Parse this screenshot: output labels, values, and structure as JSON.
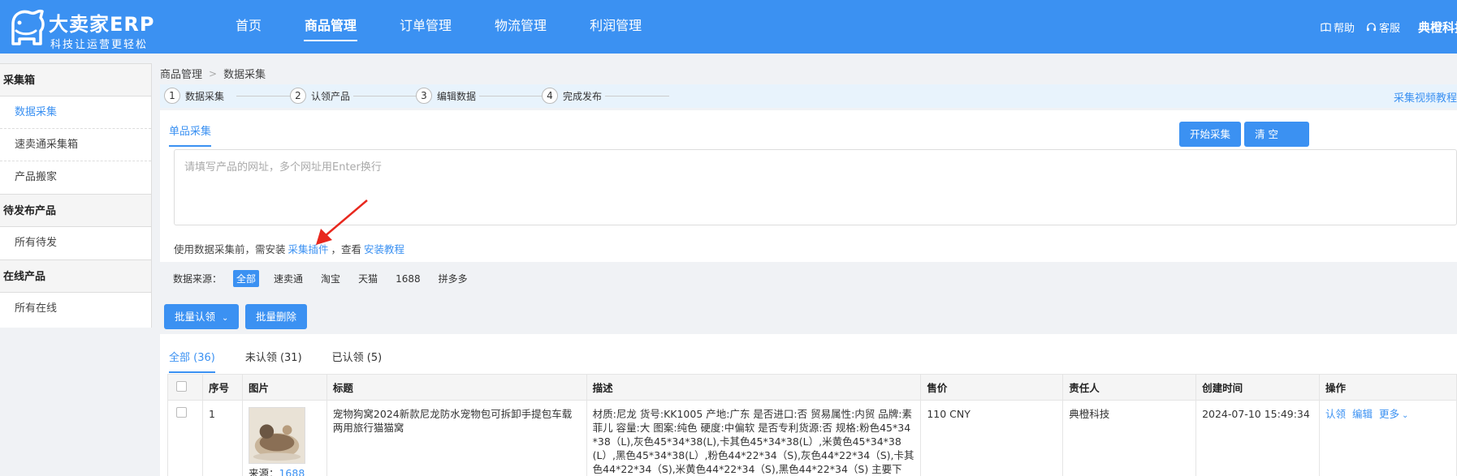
{
  "header": {
    "brand_name": "大卖家ERP",
    "slogan": "科技让运营更轻松",
    "nav": [
      "首页",
      "商品管理",
      "订单管理",
      "物流管理",
      "利润管理"
    ],
    "active_nav": 1,
    "help": "帮助",
    "service": "客服",
    "company": "典橙科技"
  },
  "sidebar": {
    "groups": [
      {
        "title": "采集箱",
        "items": [
          "数据采集",
          "速卖通采集箱",
          "产品搬家"
        ]
      },
      {
        "title": "待发布产品",
        "items": [
          "所有待发"
        ]
      },
      {
        "title": "在线产品",
        "items": [
          "所有在线"
        ]
      }
    ]
  },
  "breadcrumb": [
    "商品管理",
    "数据采集"
  ],
  "steps": [
    {
      "num": "1",
      "label": "数据采集"
    },
    {
      "num": "2",
      "label": "认领产品"
    },
    {
      "num": "3",
      "label": "编辑数据"
    },
    {
      "num": "4",
      "label": "完成发布"
    }
  ],
  "video_link": "采集视频教程",
  "collect": {
    "tab": "单品采集",
    "placeholder": "请填写产品的网址，多个网址用Enter换行",
    "hint_prefix": "使用数据采集前，需安装",
    "hint_plugin": "采集插件",
    "hint_mid": "，查看",
    "hint_tutorial": "安装教程",
    "start_btn": "开始采集",
    "clear_btn": "清 空"
  },
  "source": {
    "label": "数据来源：",
    "options": [
      "全部",
      "速卖通",
      "淘宝",
      "天猫",
      "1688",
      "拼多多"
    ]
  },
  "bulk": {
    "claim": "批量认领",
    "delete": "批量删除"
  },
  "list_tabs": [
    "全部 (36)",
    "未认领 (31)",
    "已认领 (5)"
  ],
  "table": {
    "headers": [
      "",
      "序号",
      "图片",
      "标题",
      "描述",
      "售价",
      "责任人",
      "创建时间",
      "操作"
    ],
    "rows": [
      {
        "index": "1",
        "source_label": "来源：",
        "source_value": "1688",
        "title": "宠物狗窝2024新款尼龙防水宠物包可拆卸手提包车载两用旅行猫猫窝",
        "desc": "材质:尼龙 货号:KK1005 产地:广东 是否进口:否 贸易属性:内贸 品牌:素菲儿 容量:大 图案:纯色 硬度:中偏软 是否专利货源:否 规格:粉色45*34*38（L),灰色45*34*38(L),卡其色45*34*38(L）,米黄色45*34*38(L）,黑色45*34*38(L）,粉色44*22*34（S),灰色44*22*34（S),卡其色44*22*34（S),米黄色44*22*34（S),黑色44*22*34（S) 主要下",
        "price": "110 CNY",
        "owner": "典橙科技",
        "created": "2024-07-10 15:49:34",
        "ops": [
          "认领",
          "编辑",
          "更多"
        ]
      }
    ]
  }
}
